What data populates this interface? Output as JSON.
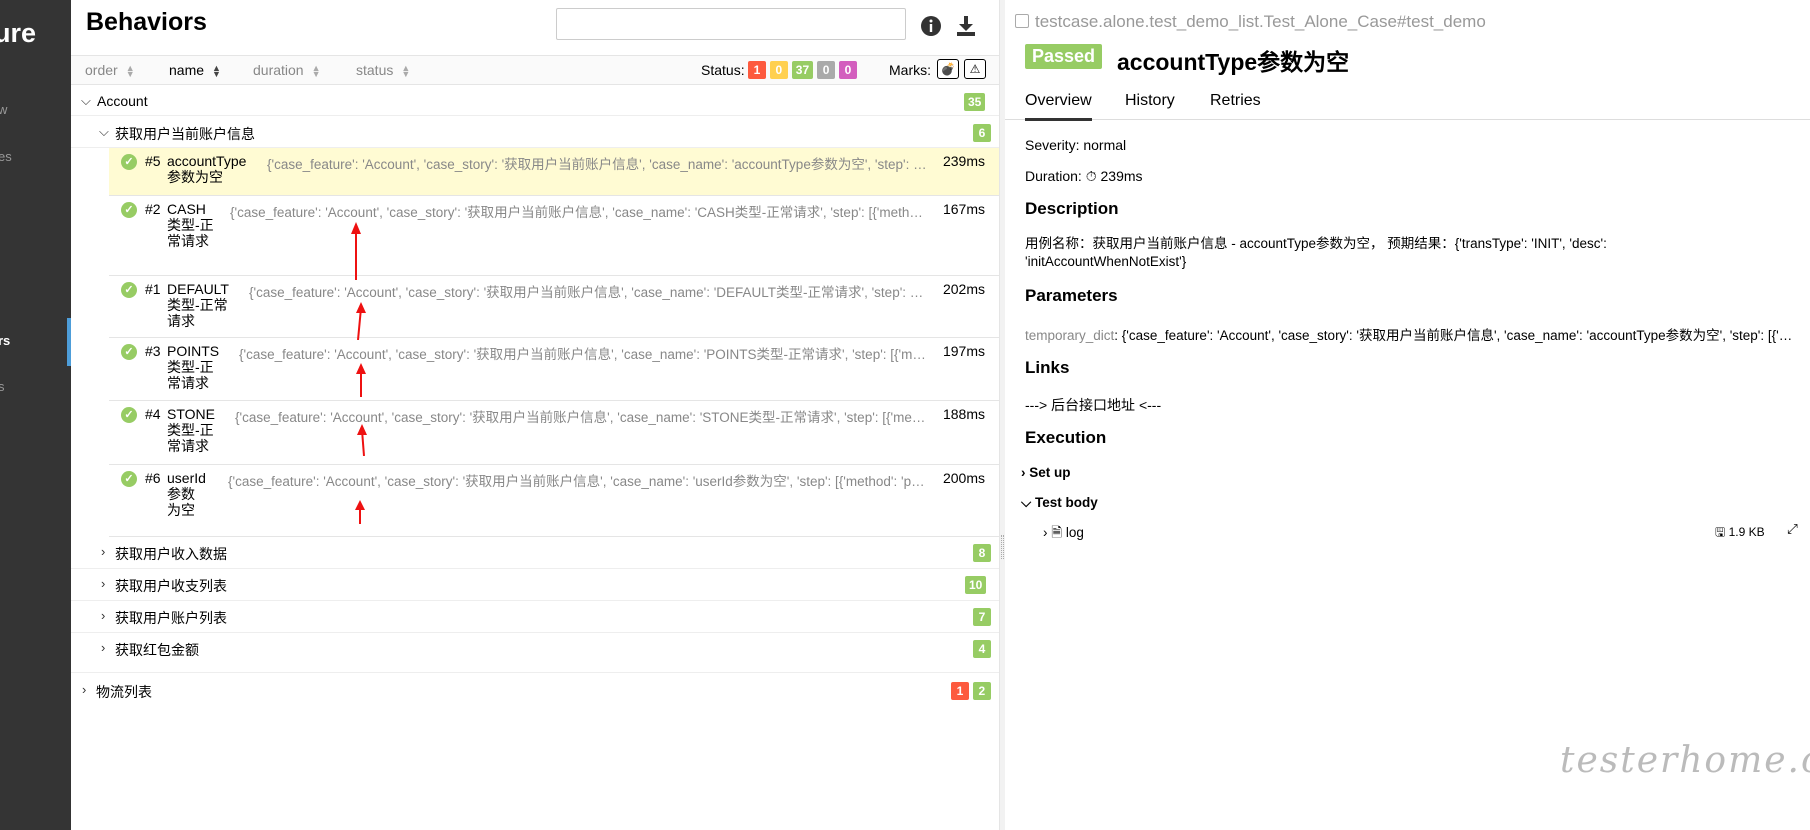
{
  "app": {
    "logo_fragment": "ure"
  },
  "sidebar": {
    "items": [
      {
        "label": "w",
        "active": false
      },
      {
        "label": "es",
        "active": false
      },
      {
        "label": "rs",
        "active": true
      },
      {
        "label": "s",
        "active": false
      }
    ]
  },
  "tree": {
    "title": "Behaviors",
    "search": {
      "value": "",
      "placeholder": ""
    },
    "icons": {
      "info": "info-icon",
      "download": "download-icon"
    },
    "sort": {
      "columns": [
        {
          "label": "order",
          "active": false
        },
        {
          "label": "name",
          "active": true
        },
        {
          "label": "duration",
          "active": false
        },
        {
          "label": "status",
          "active": false
        }
      ],
      "status_label": "Status:",
      "status_counts": [
        {
          "value": "1",
          "color": "#fd5a3e"
        },
        {
          "value": "0",
          "color": "#ffd050"
        },
        {
          "value": "37",
          "color": "#97cc64"
        },
        {
          "value": "0",
          "color": "#aaaaaa"
        },
        {
          "value": "0",
          "color": "#d35ebe"
        }
      ],
      "marks_label": "Marks:",
      "marks": [
        "flaky-icon",
        "warning-icon"
      ]
    },
    "groups": [
      {
        "label": "Account",
        "expanded": true,
        "counts": [
          "35"
        ],
        "stories": [
          {
            "label": "获取用户当前账户信息",
            "expanded": true,
            "counts": [
              "6"
            ],
            "cases": [
              {
                "num": "#5",
                "name": "accountType参数为空",
                "params": "{'case_feature': 'Account', 'case_story': '获取用户当前账户信息', 'case_name': 'accountType参数为空', 'step': [{'method': 'post', 'url'}]}",
                "duration": "239ms",
                "selected": true
              },
              {
                "num": "#2",
                "name": "CASH类型-正常请求",
                "params": "{'case_feature': 'Account', 'case_story': '获取用户当前账户信息', 'case_name': 'CASH类型-正常请求', 'step': [{'method': 'post'}]}",
                "duration": "167ms",
                "selected": false
              },
              {
                "num": "#1",
                "name": "DEFAULT类型-正常请求",
                "params": "{'case_feature': 'Account', 'case_story': '获取用户当前账户信息', 'case_name': 'DEFAULT类型-正常请求', 'step': [{'method': 'post'}]}",
                "duration": "202ms",
                "selected": false
              },
              {
                "num": "#3",
                "name": "POINTS类型-正常请求",
                "params": "{'case_feature': 'Account', 'case_story': '获取用户当前账户信息', 'case_name': 'POINTS类型-正常请求', 'step': [{'method': 'post'}]}",
                "duration": "197ms",
                "selected": false
              },
              {
                "num": "#4",
                "name": "STONE类型-正常请求",
                "params": "{'case_feature': 'Account', 'case_story': '获取用户当前账户信息', 'case_name': 'STONE类型-正常请求', 'step': [{'method': 'post'}]}",
                "duration": "188ms",
                "selected": false
              },
              {
                "num": "#6",
                "name": "userId参数为空",
                "params": "{'case_feature': 'Account', 'case_story': '获取用户当前账户信息', 'case_name': 'userId参数为空', 'step': [{'method': 'post'}]}",
                "duration": "200ms",
                "selected": false
              }
            ]
          },
          {
            "label": "获取用户收入数据",
            "expanded": false,
            "counts": [
              "8"
            ]
          },
          {
            "label": "获取用户收支列表",
            "expanded": false,
            "counts": [
              "10"
            ]
          },
          {
            "label": "获取用户账户列表",
            "expanded": false,
            "counts": [
              "7"
            ]
          },
          {
            "label": "获取红包金额",
            "expanded": false,
            "counts": [
              "4"
            ]
          }
        ]
      },
      {
        "label": "物流列表",
        "expanded": false,
        "counts": [
          "1",
          "2"
        ],
        "count_colors": [
          "#fd5a3e",
          "#97cc64"
        ]
      }
    ]
  },
  "detail": {
    "path": "testcase.alone.test_demo_list.Test_Alone_Case#test_demo",
    "status": "Passed",
    "title": "accountType参数为空",
    "tabs": [
      "Overview",
      "History",
      "Retries"
    ],
    "severity": "Severity: normal",
    "duration": "Duration: ⏱ 239ms",
    "description_heading": "Description",
    "description": "用例名称：获取用户当前账户信息 - accountType参数为空，  预期结果：{'transType': 'INIT', 'desc': 'initAccountWhenNotExist'}",
    "parameters_heading": "Parameters",
    "param_key": "temporary_dict",
    "param_value": ": {'case_feature': 'Account', 'case_story': '获取用户当前账户信息', 'case_name': 'accountType参数为空', 'step': [{'method': 'post'}]}",
    "links_heading": "Links",
    "link_text": "---> 后台接口地址 <---",
    "execution_heading": "Execution",
    "setup_label": "Set up",
    "body_label": "Test body",
    "log_label": "log",
    "log_size": "1.9 KB"
  },
  "watermark": "testerhome.com"
}
